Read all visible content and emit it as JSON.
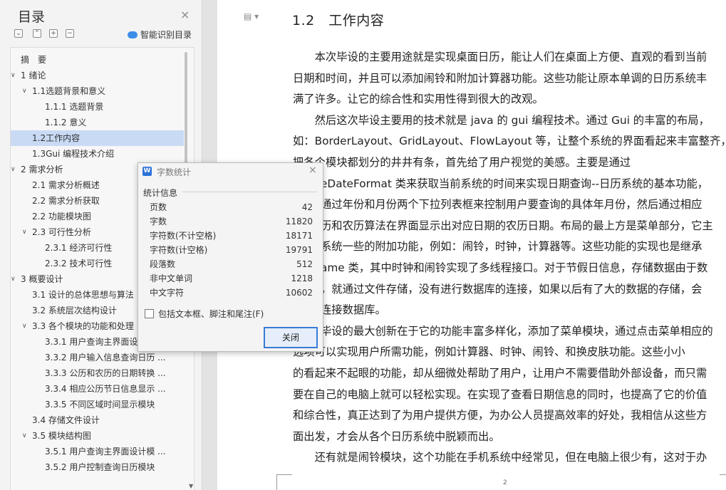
{
  "toc_panel": {
    "title": "目录",
    "close_glyph": "×",
    "toolbar": [
      "⌄",
      "⌃",
      "+",
      "−"
    ],
    "smart_toc_label": "智能识别目录",
    "items": [
      {
        "label": "摘　要",
        "level": 0,
        "chevron": ""
      },
      {
        "label": "1 绪论",
        "level": 0,
        "chevron": "v"
      },
      {
        "label": "1.1选题背景和意义",
        "level": 1,
        "chevron": "v"
      },
      {
        "label": "1.1.1 选题背景",
        "level": 2,
        "chevron": ""
      },
      {
        "label": "1.1.2 意义",
        "level": 2,
        "chevron": ""
      },
      {
        "label": "1.2工作内容",
        "level": 1,
        "chevron": "",
        "selected": true
      },
      {
        "label": "1.3Gui 编程技术介绍",
        "level": 1,
        "chevron": ""
      },
      {
        "label": "2 需求分析",
        "level": 0,
        "chevron": "v"
      },
      {
        "label": "2.1 需求分析概述",
        "level": 1,
        "chevron": ""
      },
      {
        "label": "2.2 需求分析获取",
        "level": 1,
        "chevron": ""
      },
      {
        "label": "2.2 功能模块图",
        "level": 1,
        "chevron": ""
      },
      {
        "label": "2.3 可行性分析",
        "level": 1,
        "chevron": "v"
      },
      {
        "label": "2.3.1 经济可行性",
        "level": 2,
        "chevron": ""
      },
      {
        "label": "2.3.2 技术可行性",
        "level": 2,
        "chevron": ""
      },
      {
        "label": "3 概要设计",
        "level": 0,
        "chevron": "v"
      },
      {
        "label": "3.1 设计的总体思想与算法",
        "level": 1,
        "chevron": ""
      },
      {
        "label": "3.2 系统层次结构设计",
        "level": 1,
        "chevron": ""
      },
      {
        "label": "3.3 各个模块的功能和处理",
        "level": 1,
        "chevron": "v"
      },
      {
        "label": "3.3.1 用户查询主界面设",
        "level": 2,
        "chevron": ""
      },
      {
        "label": "3.3.2 用户输入信息查询日历 ...",
        "level": 2,
        "chevron": ""
      },
      {
        "label": "3.3.3 公历和农历的日期转换 ...",
        "level": 2,
        "chevron": ""
      },
      {
        "label": "3.3.4 相应公历节日信息显示 ...",
        "level": 2,
        "chevron": ""
      },
      {
        "label": "3.3.5 不同区域时间显示模块",
        "level": 2,
        "chevron": ""
      },
      {
        "label": "3.4 存储文件设计",
        "level": 1,
        "chevron": ""
      },
      {
        "label": "3.5 模块结构图",
        "level": 1,
        "chevron": "v"
      },
      {
        "label": "3.5.1 用户查询主界面设计模 ...",
        "level": 2,
        "chevron": ""
      },
      {
        "label": "3.5.2 用户控制查询日历模块",
        "level": 2,
        "chevron": ""
      }
    ]
  },
  "document": {
    "heading": "1.2　工作内容",
    "lines": [
      {
        "text": "　　本次毕设的主要用途就是实现桌面日历，能让人们在桌面上方便、直观的看到当前"
      },
      {
        "text": "日期和时间，并且可以添加闹铃和附加计算器功能。这些功能让原本单调的日历系统丰"
      },
      {
        "text": "满了许多。让它的综合性和实用性得到很大的改观。"
      },
      {
        "text": "　　然后这次毕设主要用的技术就是 java 的 gui 编程技术。通过 Gui 的丰富的布局，"
      },
      {
        "text": "如：BorderLayout、GridLayout、FlowLayout 等，让整个系统的界面看起来丰富整齐，"
      },
      {
        "text": "把各个模块都划分的井井有条，首先给了用户视觉的美感。主要是通过"
      },
      {
        "text": "eDateFormat 类来获取当前系统的时间来实现日期查询--日历系统的基本功能，"
      },
      {
        "text": "通过年份和月份两个下拉列表框来控制用户要查询的具体年月份，然后通过相应"
      },
      {
        "text": "历和农历算法在界面显示出对应日期的农历日期。布局的最上方是菜单部分，它主"
      },
      {
        "text": "系统一些的附加功能，例如：闹铃，时钟，计算器等。这些功能的实现也是继承"
      },
      {
        "text": "ame 类，其中时钟和闹铃实现了多线程接口。对于节假日信息，存储数据由于数"
      },
      {
        "text": "，就通过文件存储，没有进行数据库的连接，如果以后有了大的数据的存储，会"
      },
      {
        "text": "连接数据库。"
      },
      {
        "text": "毕设的最大创新在于它的功能丰富多样化，添加了菜单模块，通过点击菜单相应的"
      },
      {
        "text": "选项可以实现用户所需功能，例如计算器、时钟、闹铃、和换皮肤功能。这些小小"
      },
      {
        "text": "的看起来不起眼的功能，却从细微处帮助了用户，让用户不需要借助外部设备，而只需"
      },
      {
        "text": "要在自己的电脑上就可以轻松实现。在实现了查看日期信息的同时，也提高了它的价值"
      },
      {
        "text": "和综合性，真正达到了为用户提供方便，为办公人员提高效率的好处，我相信从这些方"
      },
      {
        "text": "面出发，才会从各个日历系统中脱颖而出。"
      },
      {
        "text": "　　还有就是闹铃模块，这个功能在手机系统中经常见，但在电脑上很少有，这对于办"
      }
    ],
    "page_number": "2"
  },
  "dialog": {
    "icon_letter": "W",
    "title": "字数统计",
    "close_glyph": "×",
    "group_label": "统计信息",
    "rows": [
      {
        "label": "页数",
        "value": "42"
      },
      {
        "label": "字数",
        "value": "11820"
      },
      {
        "label": "字符数(不计空格)",
        "value": "18171"
      },
      {
        "label": "字符数(计空格)",
        "value": "19791"
      },
      {
        "label": "段落数",
        "value": "512"
      },
      {
        "label": "非中文单词",
        "value": "1218"
      },
      {
        "label": "中文字符",
        "value": "10602"
      }
    ],
    "checkbox_label": "包括文本框、脚注和尾注(F)",
    "checkbox_checked": false,
    "close_button": "关闭"
  }
}
